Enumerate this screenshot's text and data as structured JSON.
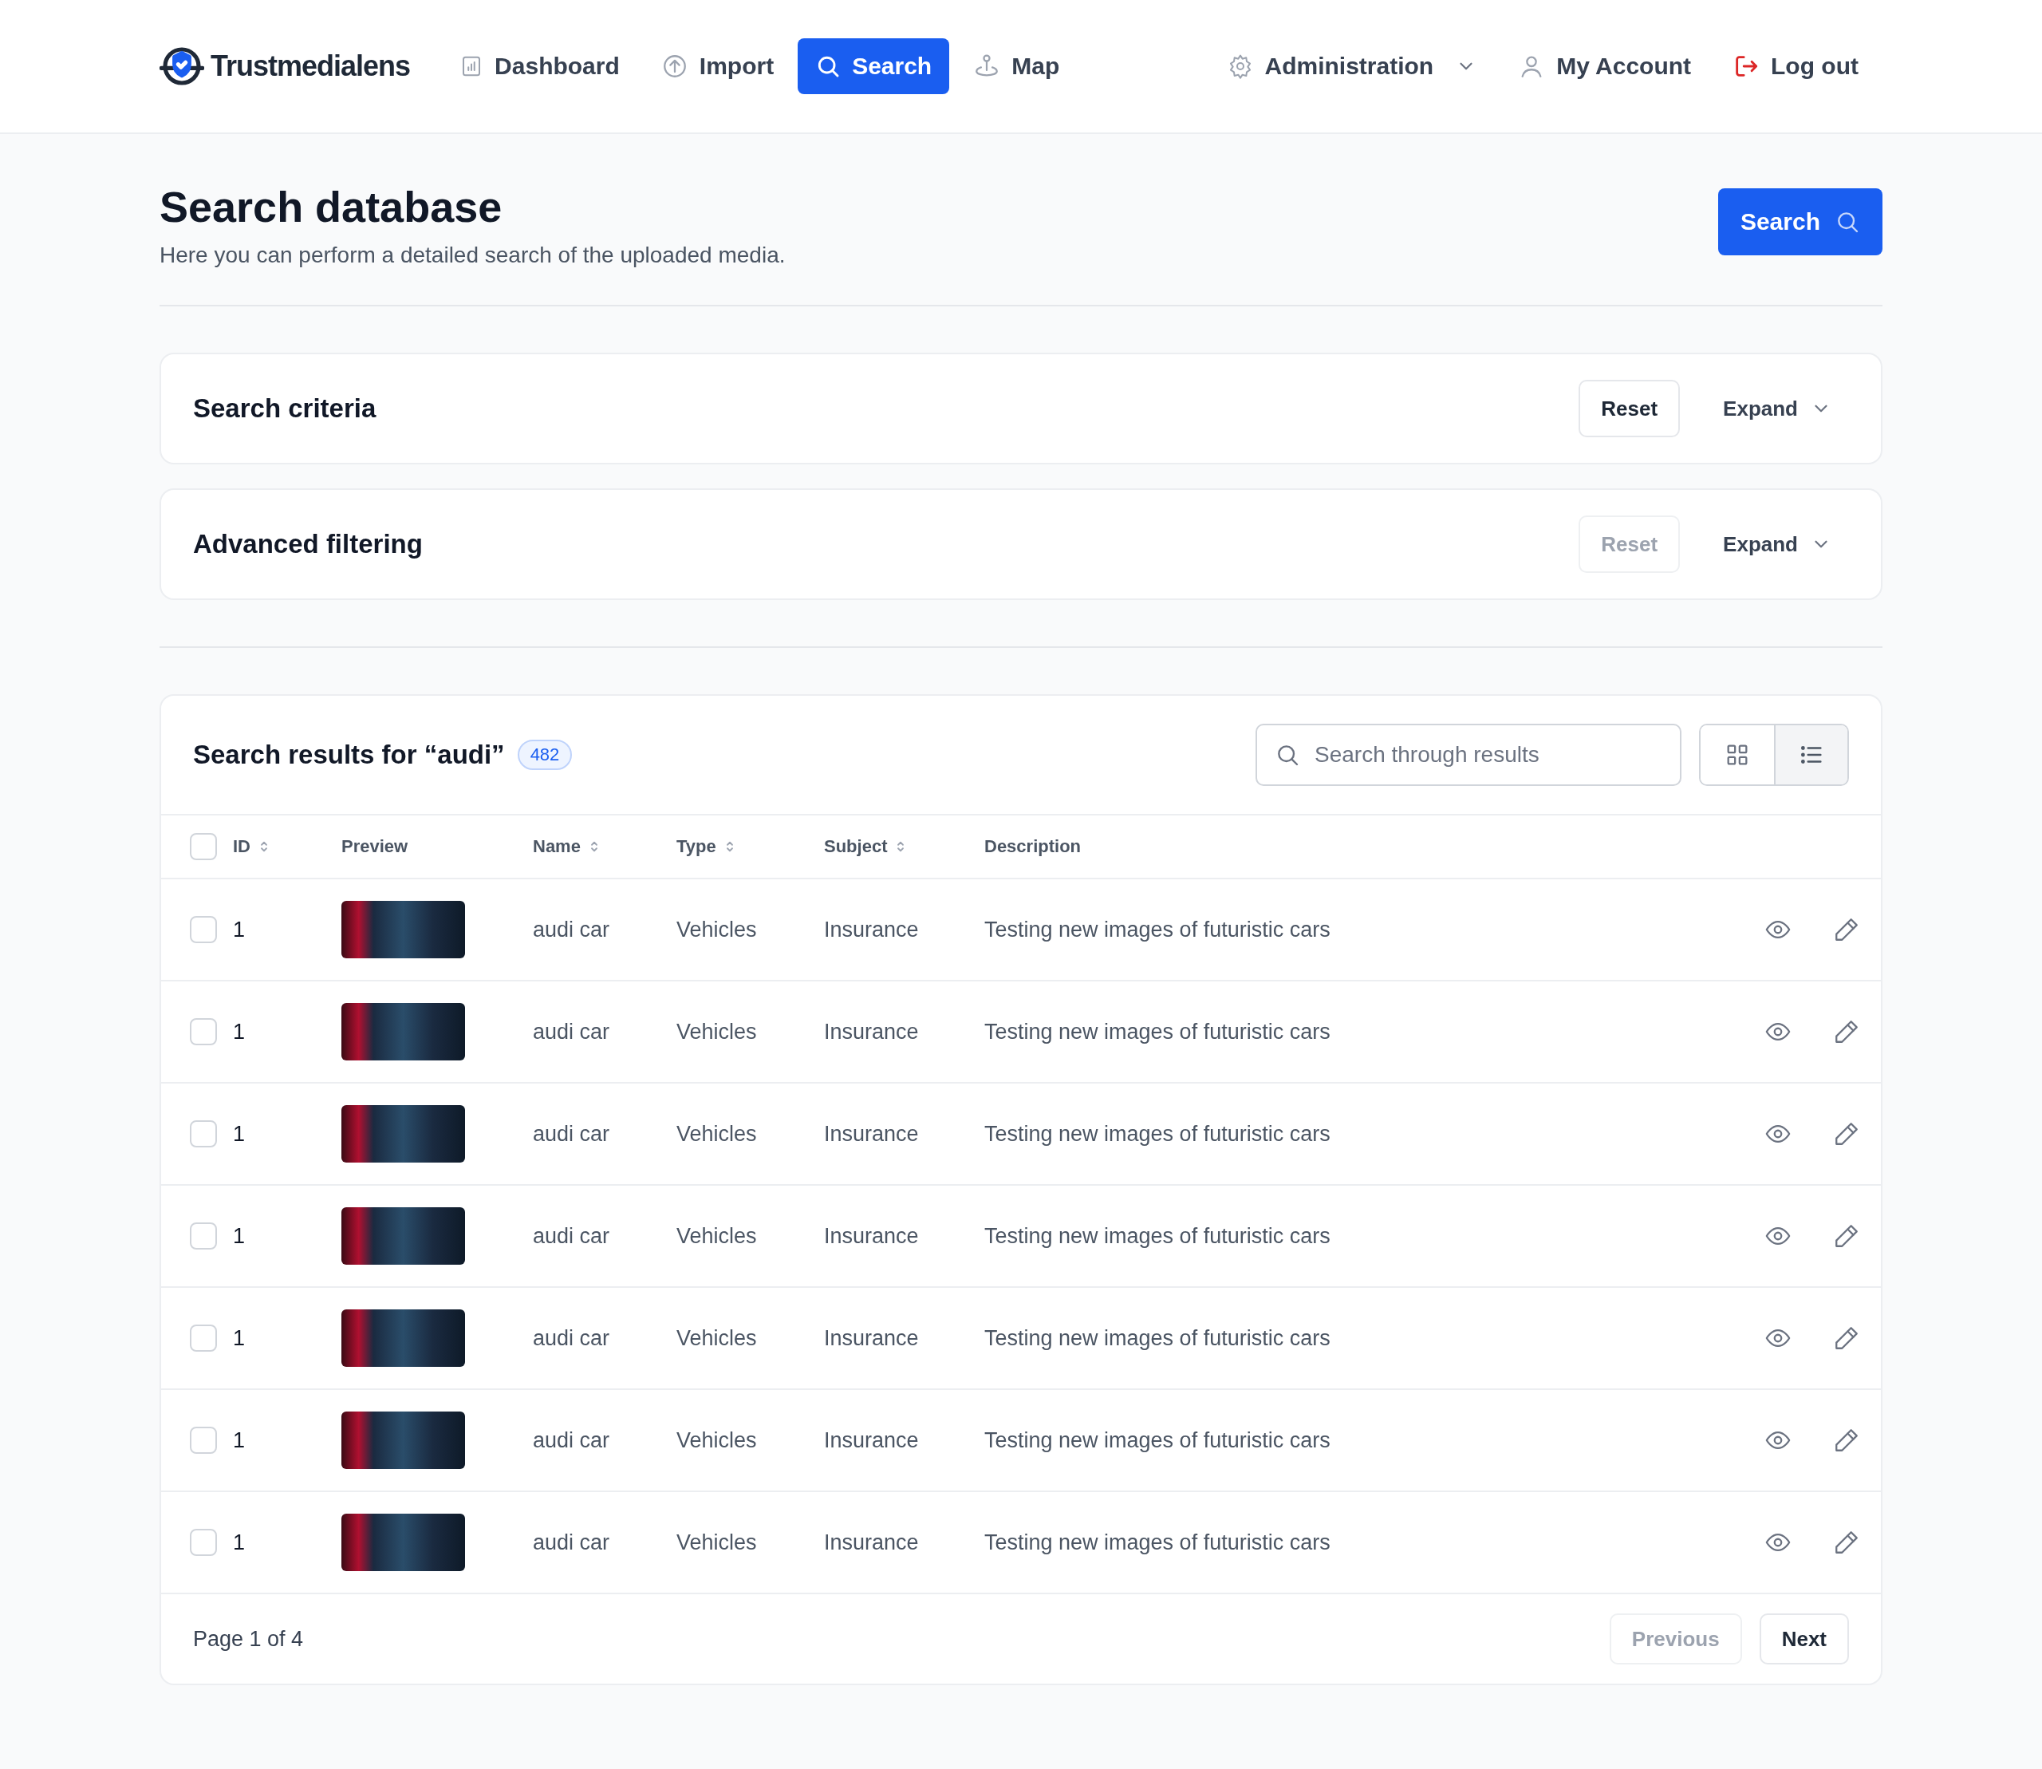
{
  "nav": {
    "logo": "Trustmedialens",
    "items": [
      {
        "label": "Dashboard",
        "selected": false
      },
      {
        "label": "Import",
        "selected": false
      },
      {
        "label": "Search",
        "selected": true
      },
      {
        "label": "Map",
        "selected": false
      }
    ],
    "right": [
      {
        "label": "Administration",
        "dropdown": true
      },
      {
        "label": "My Account",
        "dropdown": false
      },
      {
        "label": "Log out",
        "dropdown": false
      }
    ]
  },
  "header": {
    "title": "Search database",
    "subtitle": "Here you can perform a detailed search of the uploaded media.",
    "search_button": "Search"
  },
  "panels": [
    {
      "title": "Search criteria",
      "reset": {
        "label": "Reset",
        "disabled": false
      },
      "expand": "Expand"
    },
    {
      "title": "Advanced filtering",
      "reset": {
        "label": "Reset",
        "disabled": true
      },
      "expand": "Expand"
    }
  ],
  "results": {
    "title": "Search results for “audi”",
    "count": "482",
    "search_placeholder": "Search through results",
    "views": [
      {
        "kind": "grid",
        "selected": false
      },
      {
        "kind": "list",
        "selected": true
      }
    ],
    "select_all": {
      "checked": false
    },
    "columns": [
      {
        "label": "ID",
        "sortable": true
      },
      {
        "label": "Preview",
        "sortable": false
      },
      {
        "label": "Name",
        "sortable": true
      },
      {
        "label": "Type",
        "sortable": true
      },
      {
        "label": "Subject",
        "sortable": true
      },
      {
        "label": "Description",
        "sortable": false
      }
    ],
    "rows": [
      {
        "checked": false,
        "id": "1",
        "name": "audi car",
        "type": "Vehicles",
        "subject": "Insurance",
        "description": "Testing new images of futuristic cars"
      },
      {
        "checked": false,
        "id": "1",
        "name": "audi car",
        "type": "Vehicles",
        "subject": "Insurance",
        "description": "Testing new images of futuristic cars"
      },
      {
        "checked": false,
        "id": "1",
        "name": "audi car",
        "type": "Vehicles",
        "subject": "Insurance",
        "description": "Testing new images of futuristic cars"
      },
      {
        "checked": false,
        "id": "1",
        "name": "audi car",
        "type": "Vehicles",
        "subject": "Insurance",
        "description": "Testing new images of futuristic cars"
      },
      {
        "checked": false,
        "id": "1",
        "name": "audi car",
        "type": "Vehicles",
        "subject": "Insurance",
        "description": "Testing new images of futuristic cars"
      },
      {
        "checked": false,
        "id": "1",
        "name": "audi car",
        "type": "Vehicles",
        "subject": "Insurance",
        "description": "Testing new images of futuristic cars"
      },
      {
        "checked": false,
        "id": "1",
        "name": "audi car",
        "type": "Vehicles",
        "subject": "Insurance",
        "description": "Testing new images of futuristic cars"
      }
    ],
    "page": "Page 1 of 4",
    "previous": {
      "label": "Previous",
      "disabled": true
    },
    "next": {
      "label": "Next",
      "disabled": false
    }
  }
}
